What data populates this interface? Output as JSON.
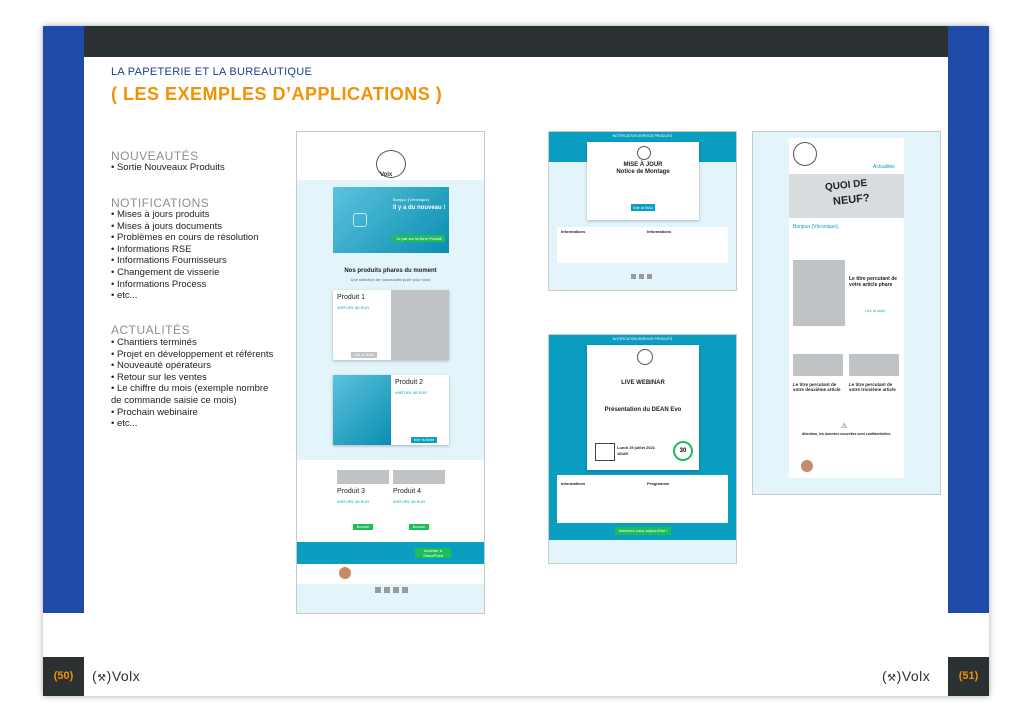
{
  "header": {
    "kicker": "LA PAPETERIE ET LA BUREAUTIQUE",
    "title": "( LES EXEMPLES D’APPLICATIONS )"
  },
  "sections": [
    {
      "title": "NOUVEAUTÉS",
      "items": [
        "Sortie Nouveaux Produits"
      ]
    },
    {
      "title": "NOTIFICATIONS",
      "items": [
        "Mises à jours produits",
        "Mises à jours documents",
        "Problèmes en cours de résolution",
        "Informations RSE",
        "Informations Fournisseurs",
        "Changement de visserie",
        "Informations Process",
        "etc..."
      ]
    },
    {
      "title": "ACTUALITÉS",
      "items": [
        "Chantiers terminés",
        "Projet en développement et référents",
        "Nouveauté opérateurs",
        "Retour sur les ventes",
        "Le chiffre du mois (exemple nombre de commande saisie ce mois)",
        "Prochain webinaire",
        "etc..."
      ]
    }
  ],
  "footer": {
    "page_left": "(50)",
    "page_right": "(51)",
    "logo": "Volx"
  },
  "mock_newsletter": {
    "logo": "Volx",
    "hero_hello": "Bonjour {Véronique}",
    "hero_title": "Il y a du nouveau !",
    "hero_button": "Je par sur la fiche Produit",
    "section_title": "Nos produits phares du moment",
    "section_sub": "Une sélection de nouveautés juste pour vous",
    "product1": "Produit 1",
    "product2": "Produit 2",
    "product3": "Produit 3",
    "product4": "Produit 4",
    "price": "49€TURL 66 EUR",
    "see_button": "Voir la fiche",
    "small_button": "Bouton",
    "cta_button": "Accéder à SharePoint"
  },
  "mock_notice": {
    "band": "NOTIFICATION SERVICE PRODUITS",
    "logo": "Volx",
    "title_line1": "MISE À JOUR",
    "title_line2": "Notice de Montage",
    "button": "Voir la MAJ",
    "info_left": "Informations",
    "info_right": "Informations"
  },
  "mock_webinar": {
    "band": "NOTIFICATION SERVICE PRODUITS",
    "logo": "Volx",
    "label": "LIVE WEBINAR",
    "title": "Présentation du DEAN Evo",
    "date": "Lundi 19 juillet 2021",
    "time": "16h00",
    "timer": "30",
    "info_left": "Informations",
    "info_right": "Programme",
    "button": "Inscrivez-vous aujourd'hui !"
  },
  "mock_actu": {
    "logo": "Volx",
    "badge": "Actualités",
    "headline_line1": "QUOI DE",
    "headline_line2": "NEUF?",
    "hello": "Bonjour {Véronique},",
    "article1_title": "Le titre percutant de votre article phare",
    "article1_button": "Lire la suite",
    "article2_title": "Le titre percutant de votre deuxième article",
    "article3_title": "Le titre percutant de votre troisième article",
    "warning_title": "Attention, les données nouvelles sont confidentielles."
  },
  "colors": {
    "accent": "#f39200",
    "blue": "#1f4aa8",
    "dark": "#2b3033",
    "teal": "#0a9ec0"
  }
}
